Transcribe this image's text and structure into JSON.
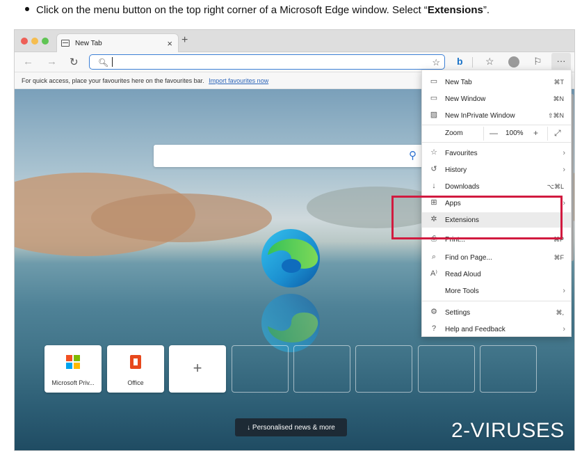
{
  "instruction": {
    "prefix": "Click on the menu button on the top right corner of a Microsoft Edge window. Select “",
    "bold": "Extensions",
    "suffix": "”."
  },
  "tab": {
    "title": "New Tab",
    "close": "×",
    "new_tab": "+"
  },
  "favourites_bar": {
    "text": "For quick access, place your favourites here on the favourites bar.",
    "link": "Import favourites now"
  },
  "new_tab_page": {
    "tiles": [
      {
        "label": "Microsoft Priv..."
      },
      {
        "label": "Office"
      },
      {
        "label": "+"
      }
    ],
    "news_button": "↓  Personalised news & more"
  },
  "menu": {
    "items": [
      {
        "label": "New Tab",
        "shortcut": "⌘T",
        "icon": "new-tab-icon"
      },
      {
        "label": "New Window",
        "shortcut": "⌘N",
        "icon": "new-window-icon"
      },
      {
        "label": "New InPrivate Window",
        "shortcut": "⇧⌘N",
        "icon": "inprivate-icon"
      }
    ],
    "zoom": {
      "label": "Zoom",
      "minus": "—",
      "value": "100%",
      "plus": "+",
      "fullscreen": "⤢"
    },
    "items2": [
      {
        "label": "Favourites",
        "arrow": "›",
        "icon": "favourites-icon"
      },
      {
        "label": "History",
        "arrow": "›",
        "icon": "history-icon"
      },
      {
        "label": "Downloads",
        "shortcut": "⌥⌘L",
        "icon": "downloads-icon"
      },
      {
        "label": "Apps",
        "arrow": "›",
        "icon": "apps-icon"
      },
      {
        "label": "Extensions",
        "icon": "extensions-icon"
      },
      {
        "label": "Print...",
        "shortcut": "⌘P",
        "icon": "print-icon"
      },
      {
        "label": "Find on Page...",
        "shortcut": "⌘F",
        "icon": "find-icon"
      },
      {
        "label": "Read Aloud",
        "icon": "read-aloud-icon"
      },
      {
        "label": "More Tools",
        "arrow": "›",
        "icon": ""
      }
    ],
    "items3": [
      {
        "label": "Settings",
        "shortcut": "⌘,",
        "icon": "settings-icon"
      },
      {
        "label": "Help and Feedback",
        "arrow": "›",
        "icon": "help-icon"
      }
    ]
  },
  "watermark": "2-VIRUSES",
  "colors": {
    "accent": "#2a63b8",
    "highlight_box": "#d11a3f",
    "menu_highlight": "#ebebeb"
  }
}
